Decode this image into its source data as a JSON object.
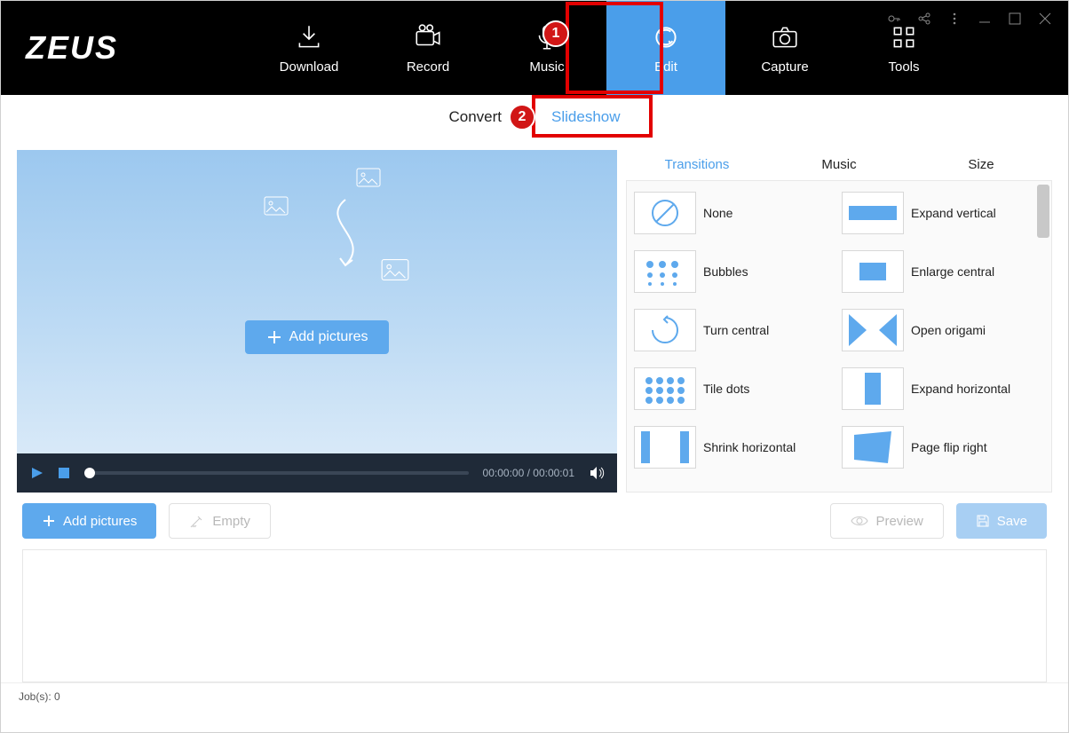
{
  "logo": "ZEUS",
  "topnav": [
    {
      "id": "download",
      "label": "Download"
    },
    {
      "id": "record",
      "label": "Record"
    },
    {
      "id": "music",
      "label": "Music"
    },
    {
      "id": "edit",
      "label": "Edit",
      "active": true
    },
    {
      "id": "capture",
      "label": "Capture"
    },
    {
      "id": "tools",
      "label": "Tools"
    }
  ],
  "subtabs": {
    "convert": "Convert",
    "slideshow": "Slideshow"
  },
  "callout": {
    "badge1": "1",
    "badge2": "2"
  },
  "preview": {
    "add_pictures": "Add pictures"
  },
  "player": {
    "time_current": "00:00:00",
    "time_total": "00:00:01"
  },
  "side_tabs": {
    "transitions": "Transitions",
    "music": "Music",
    "size": "Size"
  },
  "transitions": [
    [
      {
        "id": "none",
        "label": "None"
      },
      {
        "id": "expand_vertical",
        "label": "Expand vertical"
      }
    ],
    [
      {
        "id": "bubbles",
        "label": "Bubbles"
      },
      {
        "id": "enlarge_central",
        "label": "Enlarge central"
      }
    ],
    [
      {
        "id": "turn_central",
        "label": "Turn central"
      },
      {
        "id": "open_origami",
        "label": "Open origami"
      }
    ],
    [
      {
        "id": "tile_dots",
        "label": "Tile dots"
      },
      {
        "id": "expand_horizontal",
        "label": "Expand horizontal"
      }
    ],
    [
      {
        "id": "shrink_horizontal",
        "label": "Shrink horizontal"
      },
      {
        "id": "page_flip_right",
        "label": "Page flip right"
      }
    ]
  ],
  "buttons": {
    "add_pictures": "Add pictures",
    "empty": "Empty",
    "preview": "Preview",
    "save": "Save"
  },
  "status": {
    "jobs_label": "Job(s):",
    "jobs_count": "0"
  }
}
